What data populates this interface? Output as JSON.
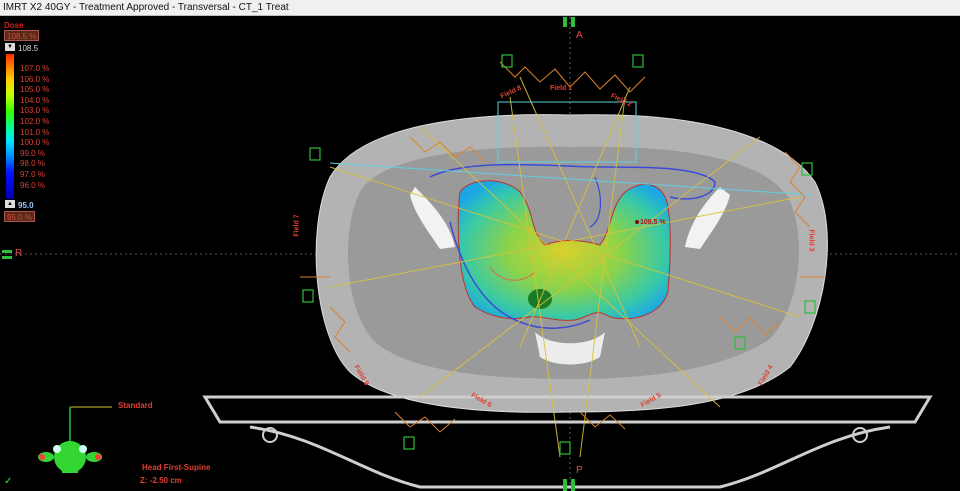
{
  "window": {
    "title": "IMRT X2 40GY  -  Treatment Approved - Transversal - CT_1 Treat"
  },
  "dose_legend": {
    "title": "Dose",
    "max_box": "108.5 %",
    "top_value": "108.5",
    "levels": [
      "107.0 %",
      "106.0 %",
      "105.0 %",
      "104.0 %",
      "103.0 %",
      "102.0 %",
      "101.0 %",
      "100.0 %",
      "99.0 %",
      "98.0 %",
      "97.0 %",
      "96.0 %"
    ],
    "bottom_value": "95.0",
    "min_box": "95.0 %",
    "colors": [
      "#ff2a00",
      "#ffd200",
      "#36ff00",
      "#00ffa2",
      "#0095ff",
      "#0000b0"
    ]
  },
  "orientation": {
    "anterior": "A",
    "posterior": "P",
    "right": "R"
  },
  "beams": {
    "labels": [
      "Field 8",
      "Field 7",
      "Field 9",
      "Field 6",
      "Field 5",
      "Field 4",
      "Field 3",
      "Field 2",
      "Field 1"
    ]
  },
  "hotspot_label": "108.5 %",
  "orientation_cube": {
    "label": "Standard"
  },
  "patient": {
    "position": "Head First-Supine",
    "z": "Z: -2.50 cm"
  },
  "status": {
    "approved_icon": "check-icon"
  }
}
